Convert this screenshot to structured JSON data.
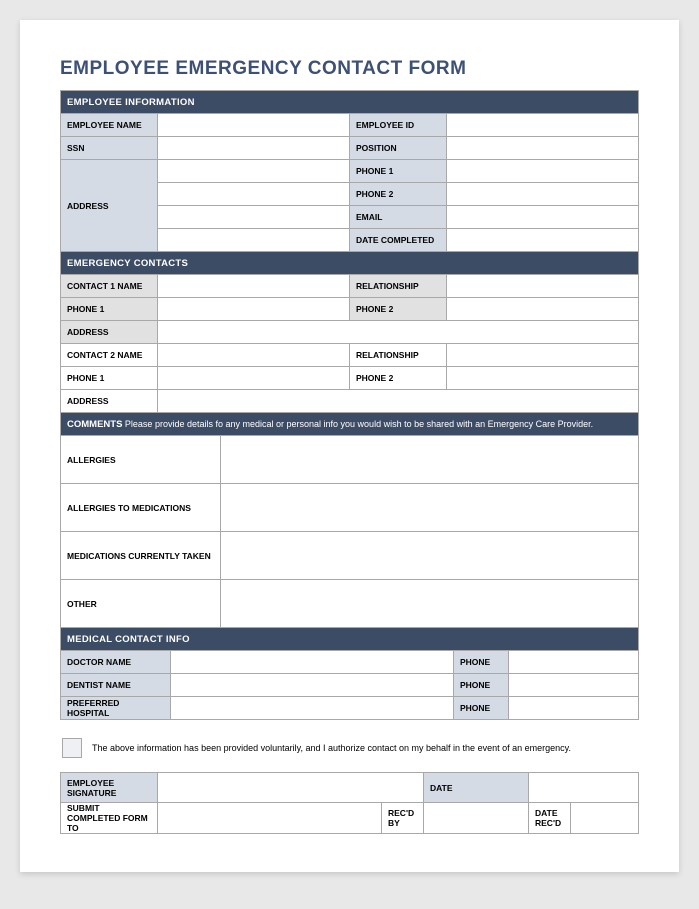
{
  "title": "EMPLOYEE EMERGENCY CONTACT FORM",
  "sections": {
    "employee_info": {
      "header": "EMPLOYEE INFORMATION",
      "employee_name_label": "EMPLOYEE NAME",
      "employee_name": "",
      "employee_id_label": "EMPLOYEE ID",
      "employee_id": "",
      "ssn_label": "SSN",
      "ssn": "",
      "position_label": "POSITION",
      "position": "",
      "address_label": "ADDRESS",
      "address1": "",
      "address2": "",
      "address3": "",
      "address4": "",
      "phone1_label": "PHONE 1",
      "phone1": "",
      "phone2_label": "PHONE 2",
      "phone2": "",
      "email_label": "EMAIL",
      "email": "",
      "date_completed_label": "DATE COMPLETED",
      "date_completed": ""
    },
    "emergency_contacts": {
      "header": "EMERGENCY CONTACTS",
      "contact1_name_label": "CONTACT 1 NAME",
      "contact1_name": "",
      "relationship_label": "RELATIONSHIP",
      "contact1_relationship": "",
      "phone1_label": "PHONE 1",
      "contact1_phone1": "",
      "phone2_label": "PHONE 2",
      "contact1_phone2": "",
      "address_label": "ADDRESS",
      "contact1_address": "",
      "contact2_name_label": "CONTACT 2 NAME",
      "contact2_name": "",
      "contact2_relationship": "",
      "contact2_phone1": "",
      "contact2_phone2": "",
      "contact2_address": ""
    },
    "comments": {
      "header_bold": "COMMENTS",
      "header_text": " Please provide details fo any medical or personal info you would wish to be shared with an Emergency Care Provider.",
      "allergies_label": "ALLERGIES",
      "allergies": "",
      "allergies_meds_label": "ALLERGIES TO MEDICATIONS",
      "allergies_meds": "",
      "medications_label": "MEDICATIONS CURRENTLY TAKEN",
      "medications": "",
      "other_label": "OTHER",
      "other": ""
    },
    "medical": {
      "header": "MEDICAL CONTACT INFO",
      "doctor_label": "DOCTOR NAME",
      "doctor": "",
      "doctor_phone_label": "PHONE",
      "doctor_phone": "",
      "dentist_label": "DENTIST NAME",
      "dentist": "",
      "dentist_phone_label": "PHONE",
      "dentist_phone": "",
      "hospital_label": "PREFERRED HOSPITAL",
      "hospital": "",
      "hospital_phone_label": "PHONE",
      "hospital_phone": ""
    },
    "authorization": {
      "text": "The above information has been provided voluntarily, and I authorize contact on my behalf in the event of an emergency."
    },
    "signature": {
      "signature_label": "EMPLOYEE SIGNATURE",
      "signature": "",
      "date_label": "DATE",
      "date": "",
      "submit_to_label": "SUBMIT COMPLETED FORM TO",
      "submit_to": "",
      "recd_by_label": "REC'D BY",
      "recd_by": "",
      "date_recd_label": "DATE REC'D",
      "date_recd": ""
    }
  }
}
